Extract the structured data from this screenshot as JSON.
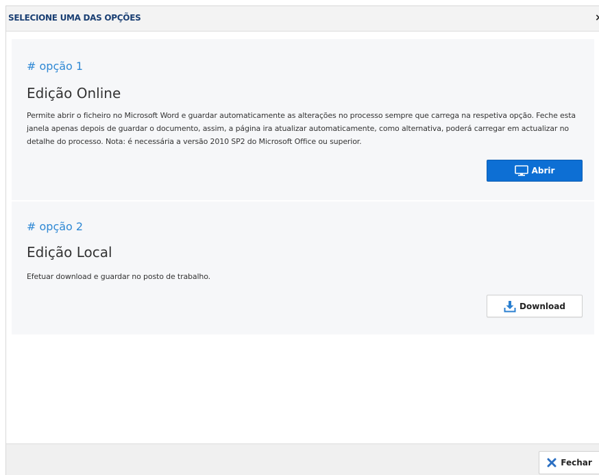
{
  "dialog": {
    "title": "SELECIONE UMA DAS OPÇÕES",
    "close_glyph": "×"
  },
  "options": [
    {
      "tag": "# opção 1",
      "title": "Edição Online",
      "description": "Permite abrir o ficheiro no Microsoft Word e guardar automaticamente as alterações no processo sempre que carrega na respetiva opção. Feche esta janela apenas depois de guardar o documento, assim, a página ira atualizar automaticamente, como alternativa, poderá carregar em actualizar no detalhe do processo. Nota: é necessária a versão 2010 SP2 do Microsoft Office ou superior.",
      "button_label": "Abrir",
      "button_icon": "monitor-icon"
    },
    {
      "tag": "# opção 2",
      "title": "Edição Local",
      "description": "Efetuar download e guardar no posto de trabalho.",
      "button_label": "Download",
      "button_icon": "download-icon"
    }
  ],
  "footer": {
    "close_label": "Fechar",
    "close_icon": "x-icon"
  },
  "colors": {
    "accent": "#0d6fd4",
    "tag": "#2e88d4",
    "title_bar_text": "#1a3f73",
    "close_x": "#2b6fc2"
  }
}
